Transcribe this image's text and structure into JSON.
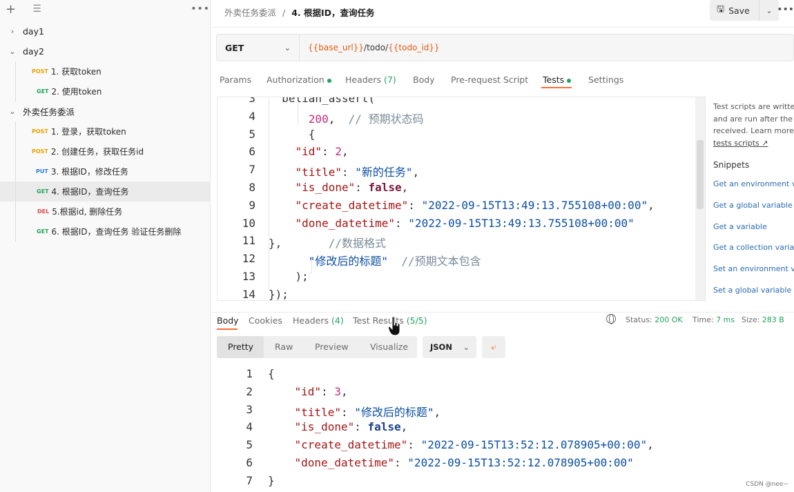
{
  "sidebar": {
    "filter_icon": "filter-lines-icon",
    "tree": [
      {
        "type": "folder",
        "label": "day1",
        "expanded": false
      },
      {
        "type": "folder",
        "label": "day2",
        "expanded": true
      },
      {
        "type": "request",
        "method": "POST",
        "label": "1. 获取token"
      },
      {
        "type": "request",
        "method": "GET",
        "label": "2. 使用token"
      },
      {
        "type": "folder",
        "label": "外卖任务委派",
        "expanded": true
      },
      {
        "type": "request",
        "method": "POST",
        "label": "1. 登录，获取token"
      },
      {
        "type": "request",
        "method": "POST",
        "label": "2. 创建任务，获取任务id"
      },
      {
        "type": "request",
        "method": "PUT",
        "label": "3. 根据ID，修改任务"
      },
      {
        "type": "request",
        "method": "GET",
        "label": "4. 根据ID，查询任务",
        "selected": true
      },
      {
        "type": "request",
        "method": "DEL",
        "label": "5.根据id, 删除任务"
      },
      {
        "type": "request",
        "method": "GET",
        "label": "6. 根据ID，查询任务 验证任务删除"
      }
    ]
  },
  "header": {
    "breadcrumb_parent": "外卖任务委派",
    "breadcrumb_sep": "/",
    "breadcrumb_current": "4. 根据ID，查询任务",
    "save_label": "Save"
  },
  "request": {
    "method": "GET",
    "url_parts": [
      {
        "text": "{{base_url}}",
        "var": true
      },
      {
        "text": "/todo/",
        "var": false
      },
      {
        "text": "{{todo_id}}",
        "var": true
      }
    ]
  },
  "request_tabs": [
    {
      "label": "Params"
    },
    {
      "label": "Authorization",
      "dot": true
    },
    {
      "label": "Headers",
      "count": "(7)"
    },
    {
      "label": "Body"
    },
    {
      "label": "Pre-request Script"
    },
    {
      "label": "Tests",
      "dot": true,
      "active": true
    },
    {
      "label": "Settings"
    }
  ],
  "script": {
    "lines": [
      {
        "n": "3",
        "html": "  belian_assert("
      },
      {
        "n": "4",
        "html": "      <span class='n'>200</span>,  <span class='c'>// 预期状态码</span>"
      },
      {
        "n": "5",
        "html": "      {"
      },
      {
        "n": "6",
        "html": "    <span class='k'>\"id\"</span>: <span class='n'>2</span>,"
      },
      {
        "n": "7",
        "html": "    <span class='k'>\"title\"</span>: <span class='s'>\"新的任务\"</span>,"
      },
      {
        "n": "8",
        "html": "    <span class='k'>\"is_done\"</span>: <span class='kw'>false</span>,"
      },
      {
        "n": "9",
        "html": "    <span class='k'>\"create_datetime\"</span>: <span class='s'>\"2022-09-15T13:49:13.755108+00:00\"</span>,"
      },
      {
        "n": "10",
        "html": "    <span class='k'>\"done_datetime\"</span>: <span class='s'>\"2022-09-15T13:49:13.755108+00:00\"</span>"
      },
      {
        "n": "11",
        "html": "},       <span class='c'>//数据格式</span>"
      },
      {
        "n": "12",
        "html": "      <span class='s'>\"修改后的标题\"</span>  <span class='c'>//预期文本包含</span>"
      },
      {
        "n": "13",
        "html": "    );"
      },
      {
        "n": "14",
        "html": "});"
      }
    ]
  },
  "hints": {
    "lines": [
      "Test scripts are writte",
      "and are run after the r",
      "received. Learn more"
    ],
    "link": "tests scripts ↗",
    "snippets_title": "Snippets",
    "snippets": [
      "Get an environment va",
      "Get a global variable",
      "Get a variable",
      "Get a collection variab",
      "Set an environment va",
      "Set a global variable"
    ]
  },
  "response_tabs": [
    {
      "label": "Body",
      "active": true
    },
    {
      "label": "Cookies"
    },
    {
      "label": "Headers",
      "count": "(4)"
    },
    {
      "label": "Test Results",
      "count": "(5/5)"
    }
  ],
  "response_status": {
    "status_label": "Status:",
    "status_value": "200 OK",
    "time_label": "Time:",
    "time_value": "7 ms",
    "size_label": "Size:",
    "size_value": "283 B"
  },
  "view_modes": [
    "Pretty",
    "Raw",
    "Preview",
    "Visualize"
  ],
  "format": "JSON",
  "response_body": {
    "lines": [
      {
        "n": "1",
        "html": "{"
      },
      {
        "n": "2",
        "html": "    <span class='k'>\"id\"</span>: <span class='n'>3</span>,"
      },
      {
        "n": "3",
        "html": "    <span class='k'>\"title\"</span>: <span class='s'>\"修改后的标题\"</span>,"
      },
      {
        "n": "4",
        "html": "    <span class='k'>\"is_done\"</span>: <span class='kw' style='color:#1a3f8a'>false</span>,"
      },
      {
        "n": "5",
        "html": "    <span class='k'>\"create_datetime\"</span>: <span class='s'>\"2022-09-15T13:52:12.078905+00:00\"</span>,"
      },
      {
        "n": "6",
        "html": "    <span class='k'>\"done_datetime\"</span>: <span class='s'>\"2022-09-15T13:52:12.078905+00:00\"</span>"
      },
      {
        "n": "7",
        "html": "}"
      }
    ]
  },
  "watermark": "CSDN @nee~"
}
